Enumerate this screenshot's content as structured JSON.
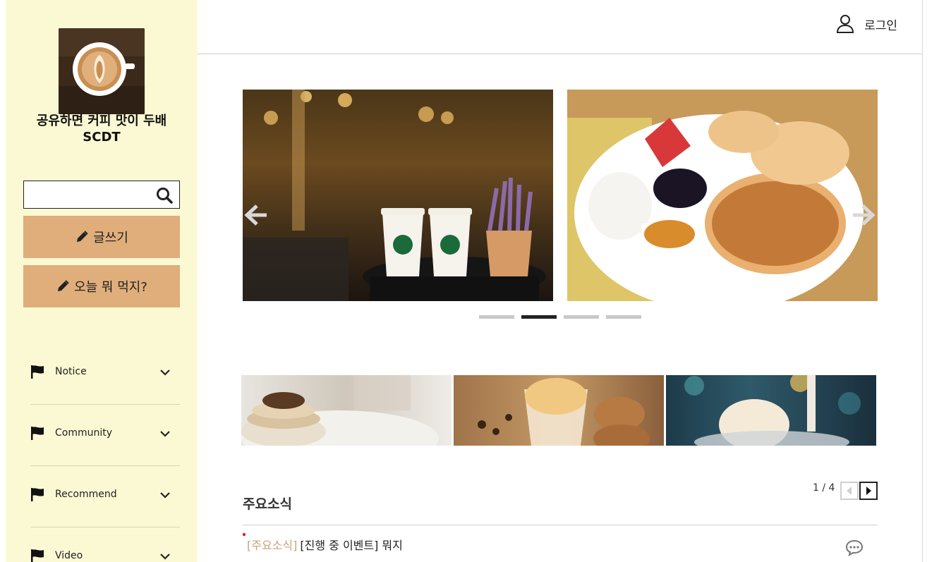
{
  "sidebar": {
    "site_title_line1": "공유하면 커피 맛이 두배",
    "site_title_line2": "SCDT",
    "search": {
      "value": "",
      "placeholder": ""
    },
    "write_button": "글쓰기",
    "menu_button": "오늘 뭐 먹지?",
    "nav": [
      {
        "label": "Notice"
      },
      {
        "label": "Community"
      },
      {
        "label": "Recommend"
      },
      {
        "label": "Video"
      }
    ]
  },
  "header": {
    "login_label": "로그인"
  },
  "slider": {
    "active_index": 1,
    "dot_count": 4
  },
  "news": {
    "title": "주요소식",
    "pager": "1 / 4",
    "items": [
      {
        "category": "[주요소식]",
        "title": "[진행 중 이벤트] 뭐지"
      }
    ]
  },
  "colors": {
    "sidebar_bg": "#fbf9d3",
    "button_bg": "#dfae7b",
    "category_text": "#c9a37b",
    "new_marker": "#ee0000"
  }
}
